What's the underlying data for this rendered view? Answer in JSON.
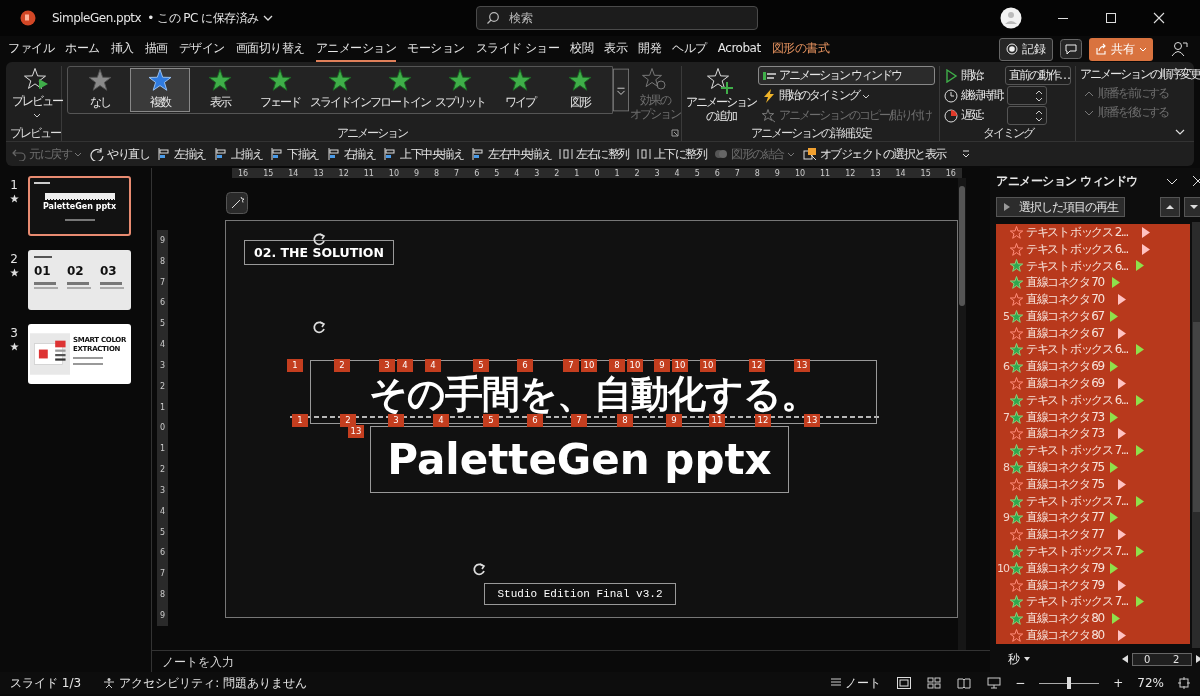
{
  "window": {
    "file_name": "SimpleGen.pptx",
    "save_status": "• この PC に保存済み",
    "search_placeholder": "検索"
  },
  "menu_tabs": [
    {
      "label": "ファイル",
      "selected": false,
      "kind": "tab"
    },
    {
      "label": "ホーム",
      "selected": false,
      "kind": "tab"
    },
    {
      "label": "挿入",
      "selected": false,
      "kind": "tab"
    },
    {
      "label": "描画",
      "selected": false,
      "kind": "tab"
    },
    {
      "label": "デザイン",
      "selected": false,
      "kind": "tab"
    },
    {
      "label": "画面切り替え",
      "selected": false,
      "kind": "tab"
    },
    {
      "label": "アニメーション",
      "selected": true,
      "kind": "tab"
    },
    {
      "label": "モーション",
      "selected": false,
      "kind": "tab"
    },
    {
      "label": "スライド ショー",
      "selected": false,
      "kind": "tab"
    },
    {
      "label": "校閲",
      "selected": false,
      "kind": "tab"
    },
    {
      "label": "表示",
      "selected": false,
      "kind": "tab"
    },
    {
      "label": "開発",
      "selected": false,
      "kind": "tab"
    },
    {
      "label": "ヘルプ",
      "selected": false,
      "kind": "tab"
    },
    {
      "label": "Acrobat",
      "selected": false,
      "kind": "tab"
    },
    {
      "label": "図形の書式",
      "selected": false,
      "kind": "contextual"
    }
  ],
  "header_actions": {
    "record": "記録",
    "share": "共有"
  },
  "ribbon": {
    "preview_button": "プレビュー",
    "preview_group": "プレビュー",
    "effects": [
      {
        "label": "なし",
        "kind": "none",
        "selected": false
      },
      {
        "label": "複数",
        "kind": "multiple",
        "selected": true
      },
      {
        "label": "表示",
        "kind": "effect",
        "selected": false
      },
      {
        "label": "フェード",
        "kind": "effect",
        "selected": false
      },
      {
        "label": "スライドイン",
        "kind": "effect",
        "selected": false
      },
      {
        "label": "フロートイン",
        "kind": "effect",
        "selected": false
      },
      {
        "label": "スプリット",
        "kind": "effect",
        "selected": false
      },
      {
        "label": "ワイプ",
        "kind": "effect",
        "selected": false
      },
      {
        "label": "図形",
        "kind": "effect",
        "selected": false
      }
    ],
    "effect_options": {
      "lines": [
        "効果の",
        "オプション"
      ],
      "disabled": true
    },
    "animation_group": "アニメーション",
    "add_animation": {
      "lines": [
        "アニメーション",
        "の追加"
      ]
    },
    "advanced": [
      {
        "label": "アニメーション ウィンドウ",
        "kind": "pane",
        "on": true,
        "disabled": false
      },
      {
        "label": "開始のタイミング",
        "kind": "trigger",
        "on": false,
        "disabled": false
      },
      {
        "label": "アニメーションのコピー/貼り付け",
        "kind": "painter",
        "on": false,
        "disabled": true
      }
    ],
    "advanced_group": "アニメーションの詳細設定",
    "timing": [
      {
        "label": "開始:",
        "kind": "start",
        "value": "直前の動作…"
      },
      {
        "label": "継続時間:",
        "kind": "duration"
      },
      {
        "label": "遅延:",
        "kind": "delay"
      }
    ],
    "timing_group": "タイミング",
    "reorder": {
      "title": "アニメーションの順序変更",
      "items": [
        {
          "label": "順番を前にする",
          "kind": "earlier",
          "disabled": true
        },
        {
          "label": "順番を後にする",
          "kind": "later",
          "disabled": true
        }
      ]
    }
  },
  "quick_access": [
    {
      "label": "元に戻す",
      "kind": "undo",
      "disabled": true
    },
    {
      "label": "やり直し",
      "kind": "redo",
      "disabled": false
    },
    {
      "label": "左揃え",
      "kind": "align",
      "disabled": false
    },
    {
      "label": "上揃え",
      "kind": "align",
      "disabled": false
    },
    {
      "label": "下揃え",
      "kind": "align",
      "disabled": false
    },
    {
      "label": "右揃え",
      "kind": "align",
      "disabled": false
    },
    {
      "label": "上下中央揃え",
      "kind": "align",
      "disabled": false
    },
    {
      "label": "左右中央揃え",
      "kind": "align",
      "disabled": false
    },
    {
      "label": "左右に整列",
      "kind": "distribute",
      "disabled": false
    },
    {
      "label": "上下に整列",
      "kind": "distribute",
      "disabled": false
    },
    {
      "label": "図形の結合",
      "kind": "merge",
      "disabled": true
    },
    {
      "label": "オブジェクトの選択と表示",
      "kind": "selection",
      "disabled": false
    }
  ],
  "slides": [
    {
      "number": "1",
      "selected": true,
      "kind": "title",
      "texts": [
        "PaletteGen pptx"
      ]
    },
    {
      "number": "2",
      "selected": false,
      "kind": "steps",
      "texts": [
        "01",
        "02",
        "03"
      ]
    },
    {
      "number": "3",
      "selected": false,
      "kind": "feature",
      "texts": [
        "SMART COLOR",
        "EXTRACTION"
      ]
    }
  ],
  "ruler": {
    "horizontal": [
      "16",
      "15",
      "14",
      "13",
      "12",
      "11",
      "10",
      "9",
      "8",
      "7",
      "6",
      "5",
      "4",
      "3",
      "2",
      "1",
      "0",
      "1",
      "2",
      "3",
      "4",
      "5",
      "6",
      "7",
      "8",
      "9",
      "10",
      "11",
      "12",
      "13",
      "14",
      "15",
      "16"
    ],
    "vertical": [
      "9",
      "8",
      "7",
      "6",
      "5",
      "4",
      "3",
      "2",
      "1",
      "0",
      "1",
      "2",
      "3",
      "4",
      "5",
      "6",
      "7",
      "8",
      "9"
    ]
  },
  "slide": {
    "section_label": "02. THE SOLUTION",
    "headline": "その手間を、自動化する。",
    "title": "PaletteGen pptx",
    "footer": "Studio Edition Final v3.2",
    "badges": [
      "1",
      "2",
      "3",
      "4",
      "4",
      "5",
      "6",
      "7",
      "10",
      "8",
      "10",
      "9",
      "10",
      "10",
      "12",
      "13",
      "1",
      "2",
      "3",
      "4",
      "5",
      "6",
      "7",
      "8",
      "9",
      "11",
      "12",
      "13",
      "13"
    ]
  },
  "notes_placeholder": "ノートを入力",
  "animation_pane": {
    "title": "アニメーション ウィンドウ",
    "play_button": "選択した項目の再生",
    "items": [
      {
        "kind": "exit",
        "name": "テキスト ボックス 2...",
        "selected": true
      },
      {
        "kind": "exit",
        "name": "テキスト ボックス 6...",
        "selected": true
      },
      {
        "kind": "entrance",
        "name": "テキスト ボックス 6...",
        "selected": true
      },
      {
        "kind": "entrance",
        "name": "直線コネクタ 70",
        "selected": true
      },
      {
        "kind": "exit",
        "name": "直線コネクタ 70",
        "selected": true
      },
      {
        "number": "5",
        "kind": "entrance",
        "name": "直線コネクタ 67",
        "selected": true
      },
      {
        "kind": "exit",
        "name": "直線コネクタ 67",
        "selected": true
      },
      {
        "kind": "entrance",
        "name": "テキスト ボックス 6...",
        "selected": true
      },
      {
        "number": "6",
        "kind": "entrance",
        "name": "直線コネクタ 69",
        "selected": true
      },
      {
        "kind": "exit",
        "name": "直線コネクタ 69",
        "selected": true
      },
      {
        "kind": "entrance",
        "name": "テキスト ボックス 6...",
        "selected": true
      },
      {
        "number": "7",
        "kind": "entrance",
        "name": "直線コネクタ 73",
        "selected": true
      },
      {
        "kind": "exit",
        "name": "直線コネクタ 73",
        "selected": true
      },
      {
        "kind": "entrance",
        "name": "テキスト ボックス 7...",
        "selected": true
      },
      {
        "number": "8",
        "kind": "entrance",
        "name": "直線コネクタ 75",
        "selected": true
      },
      {
        "kind": "exit",
        "name": "直線コネクタ 75",
        "selected": true
      },
      {
        "kind": "entrance",
        "name": "テキスト ボックス 7...",
        "selected": true
      },
      {
        "number": "9",
        "kind": "entrance",
        "name": "直線コネクタ 77",
        "selected": true
      },
      {
        "kind": "exit",
        "name": "直線コネクタ 77",
        "selected": true
      },
      {
        "kind": "entrance",
        "name": "テキスト ボックス 7...",
        "selected": true
      },
      {
        "number": "10",
        "kind": "entrance",
        "name": "直線コネクタ 79",
        "selected": true
      },
      {
        "kind": "exit",
        "name": "直線コネクタ 79",
        "selected": true
      },
      {
        "kind": "entrance",
        "name": "テキスト ボックス 7...",
        "selected": true
      },
      {
        "kind": "entrance",
        "name": "直線コネクタ 80",
        "selected": true
      },
      {
        "kind": "exit",
        "name": "直線コネクタ 80",
        "selected": true
      }
    ],
    "timeline": {
      "unit": "秒",
      "ticks": [
        "0",
        "2"
      ]
    }
  },
  "status_bar": {
    "slide": "スライド 1/3",
    "accessibility": "アクセシビリティ: 問題ありません",
    "notes": "ノート",
    "zoom_out": "−",
    "zoom_in": "+",
    "zoom": {
      "level": 0.5
    },
    "zoom_percent": "72%"
  }
}
